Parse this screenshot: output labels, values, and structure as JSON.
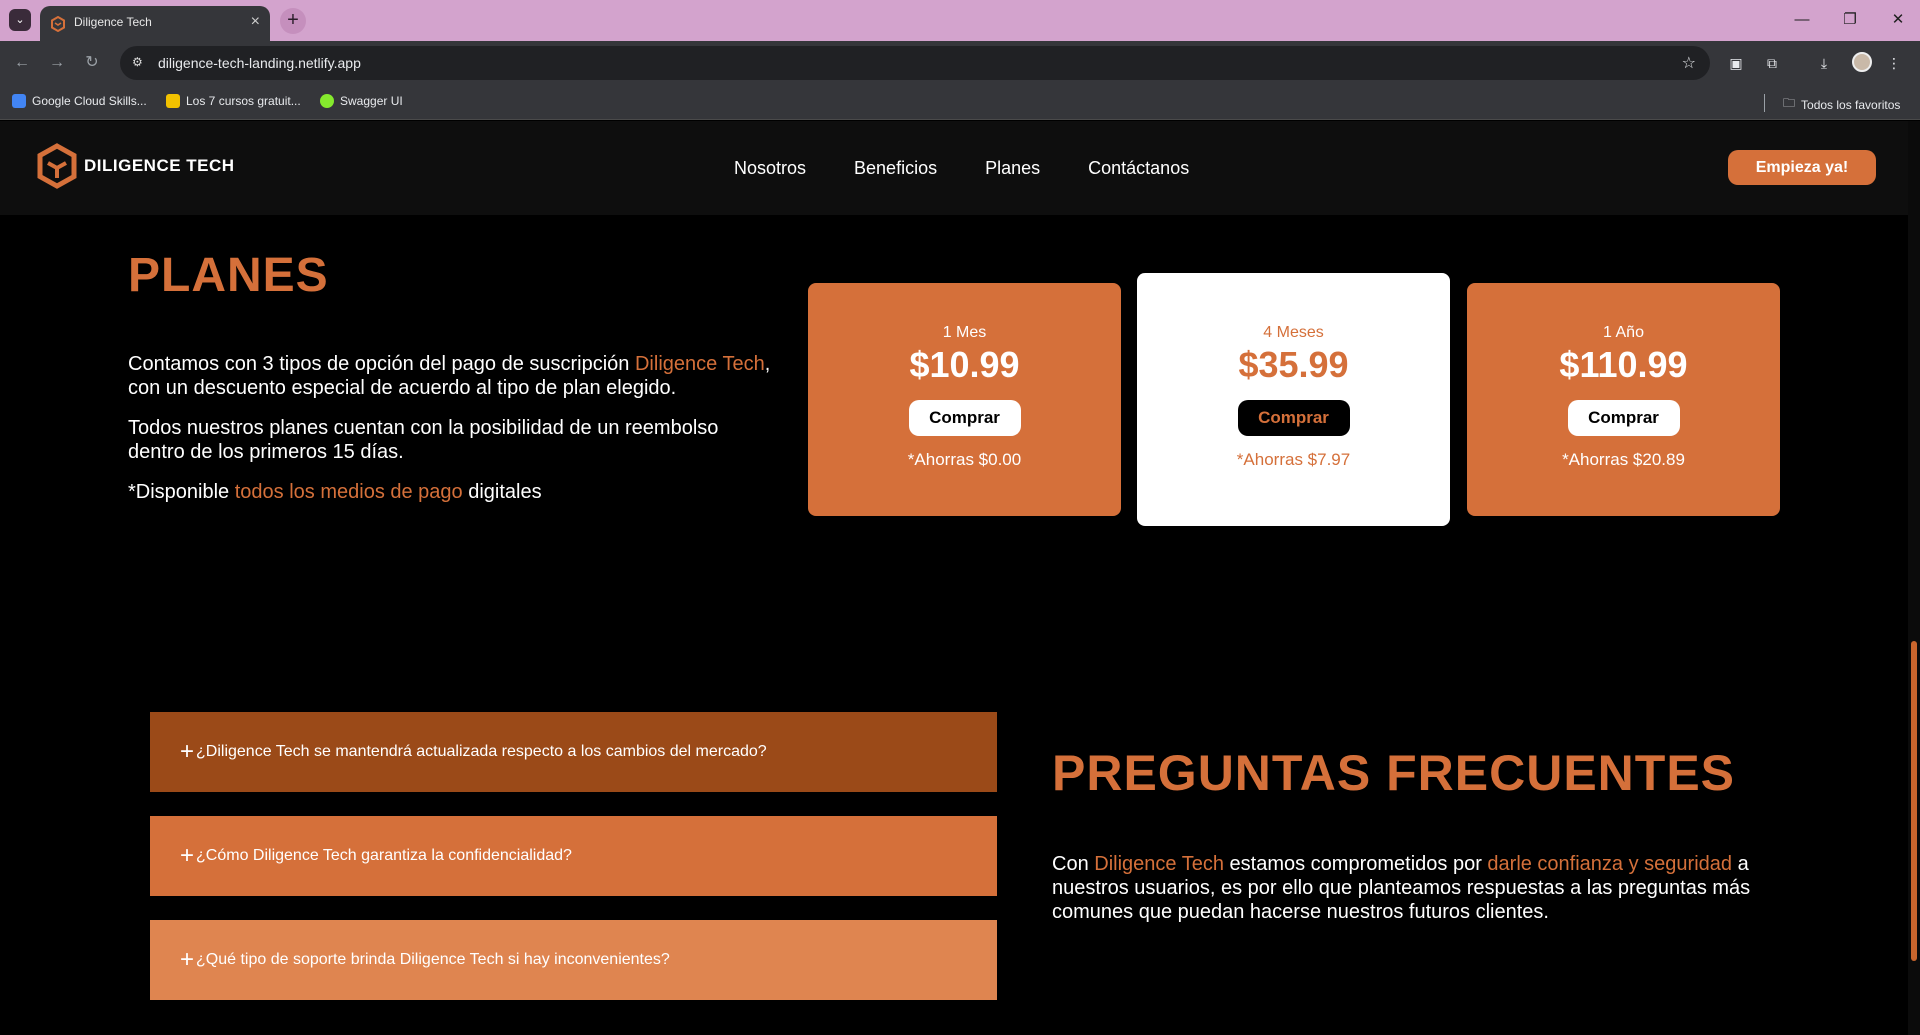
{
  "browser": {
    "tab_title": "Diligence Tech",
    "url": "diligence-tech-landing.netlify.app",
    "bookmarks": [
      {
        "label": "Google Cloud Skills...",
        "color": "#4285f4"
      },
      {
        "label": "Los 7 cursos gratuit...",
        "color": "#f2c200"
      },
      {
        "label": "Swagger UI",
        "color": "#85ea2d"
      }
    ],
    "all_bookmarks_label": "Todos los favoritos"
  },
  "header": {
    "logo_text": "DILIGENCE TECH",
    "nav": [
      "Nosotros",
      "Beneficios",
      "Planes",
      "Contáctanos"
    ],
    "cta_label": "Empieza ya!"
  },
  "plans": {
    "title": "PLANES",
    "p1_a": "Contamos con 3 tipos de opción del pago de suscripción ",
    "p1_hl": "Diligence Tech",
    "p1_b": ", con un descuento especial de acuerdo al tipo de plan elegido.",
    "p2": "Todos nuestros planes cuentan con la posibilidad de un reembolso dentro de los primeros 15 días.",
    "p3_a": "*Disponible ",
    "p3_hl": "todos los medios de pago",
    "p3_b": " digitales",
    "cards": [
      {
        "duration": "1 Mes",
        "price": "$10.99",
        "button": "Comprar",
        "saving": "*Ahorras $0.00"
      },
      {
        "duration": "4 Meses",
        "price": "$35.99",
        "button": "Comprar",
        "saving": "*Ahorras $7.97"
      },
      {
        "duration": "1 Año",
        "price": "$110.99",
        "button": "Comprar",
        "saving": "*Ahorras $20.89"
      }
    ]
  },
  "faq": {
    "title": "PREGUNTAS FRECUENTES",
    "questions": [
      "¿Diligence Tech se mantendrá actualizada respecto a los cambios del mercado?",
      "¿Cómo Diligence Tech garantiza la confidencialidad?",
      "¿Qué tipo de soporte brinda Diligence Tech si hay inconvenientes?"
    ],
    "text_a": "Con ",
    "text_hl1": "Diligence Tech",
    "text_b": " estamos comprometidos por ",
    "text_hl2": "darle confianza y seguridad",
    "text_c": " a nuestros usuarios, es por ello que planteamos respuestas a las preguntas más comunes que puedan hacerse nuestros futuros clientes."
  },
  "colors": {
    "accent": "#d5703a",
    "dark_accent": "#9b4a18",
    "light_accent": "#df8550"
  }
}
